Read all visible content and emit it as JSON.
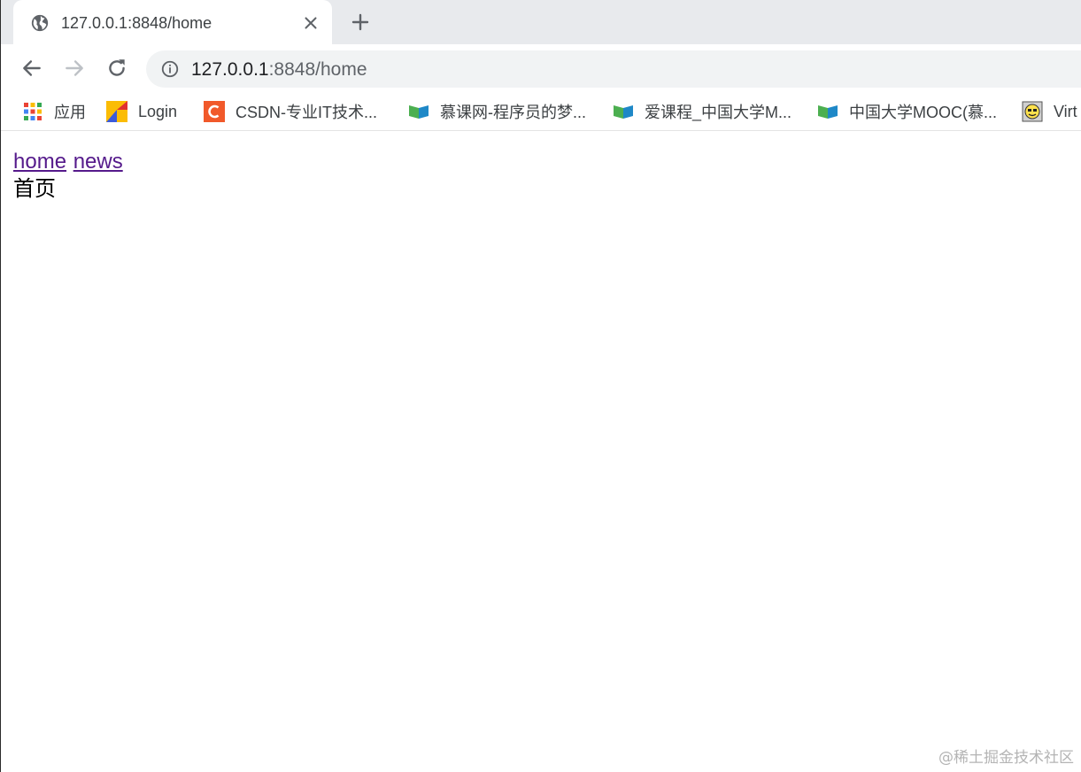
{
  "tab": {
    "title": "127.0.0.1:8848/home",
    "favicon": "globe-icon"
  },
  "address_bar": {
    "host": "127.0.0.1",
    "rest": ":8848/home"
  },
  "bookmarks": [
    {
      "label": "应用",
      "icon": "apps-grid-icon"
    },
    {
      "label": "Login",
      "icon": "login-logo-icon"
    },
    {
      "label": "CSDN-专业IT技术...",
      "icon": "csdn-logo-icon"
    },
    {
      "label": "慕课网-程序员的梦...",
      "icon": "imooc-logo-icon"
    },
    {
      "label": "爱课程_中国大学M...",
      "icon": "icourse-logo-icon"
    },
    {
      "label": "中国大学MOOC(慕...",
      "icon": "mooc-logo-icon"
    },
    {
      "label": "Virt",
      "icon": "smiley-icon"
    }
  ],
  "page": {
    "links": [
      "home",
      "news"
    ],
    "heading": "首页"
  },
  "watermark": "@稀土掘金技术社区",
  "colors": {
    "tabstrip_bg": "#e8eaed",
    "omnibox_bg": "#f1f3f4",
    "visited_link": "#551a8b",
    "csdn_red": "#f1592a",
    "mooc_green": "#4caf50",
    "mooc_blue": "#1e88c7"
  }
}
